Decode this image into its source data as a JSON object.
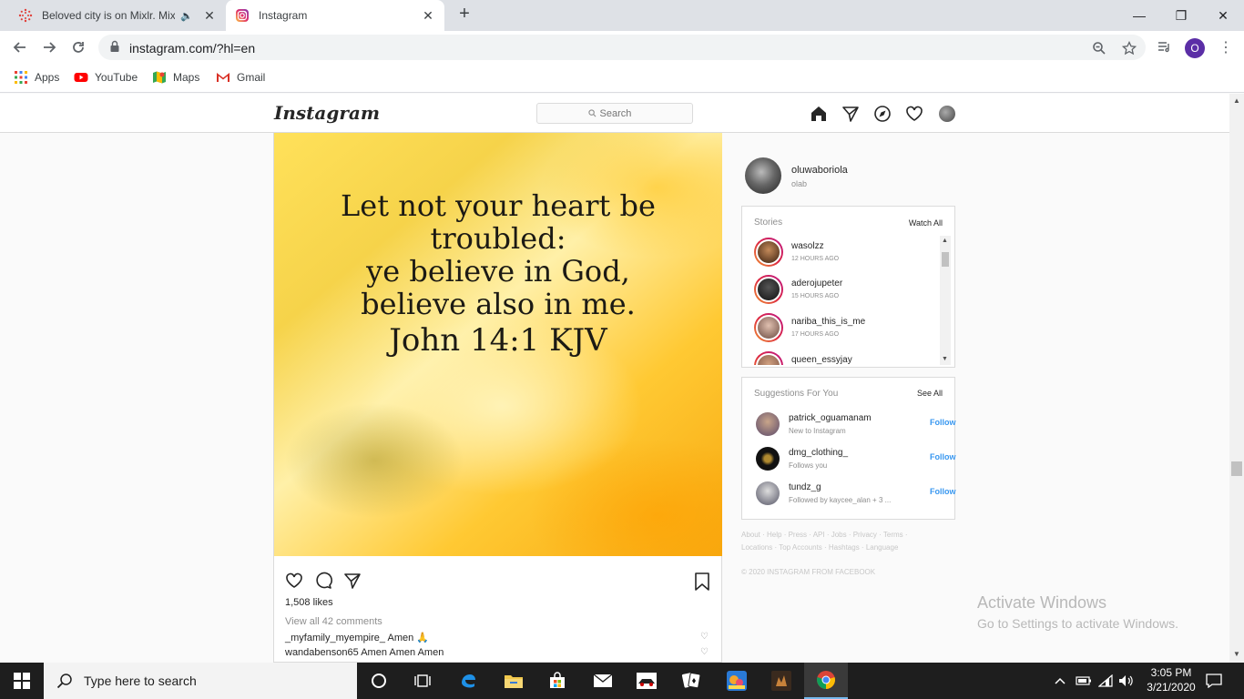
{
  "browser": {
    "tabs": [
      {
        "title": "Beloved city is on Mixlr. Mixlr",
        "audio_icon": "speaker-icon",
        "active": false
      },
      {
        "title": "Instagram",
        "active": true
      }
    ],
    "url": "instagram.com/?hl=en",
    "profile_initial": "O",
    "bookmarks": [
      {
        "label": "Apps",
        "icon": "apps-grid-icon"
      },
      {
        "label": "YouTube",
        "icon": "youtube-icon"
      },
      {
        "label": "Maps",
        "icon": "maps-icon"
      },
      {
        "label": "Gmail",
        "icon": "gmail-icon"
      }
    ]
  },
  "instagram": {
    "logo": "Instagram",
    "search_placeholder": "Search",
    "post": {
      "verse_lines": [
        "Let not your heart be troubled:",
        "ye believe in God,",
        "believe also in me."
      ],
      "reference": "John 14:1 KJV",
      "likes": "1,508 likes",
      "view_comments": "View all 42 comments",
      "comments": [
        {
          "user": "_myfamily_myempire_",
          "text": "Amen 🙏"
        },
        {
          "user": "wandabenson65",
          "text": "Amen Amen Amen"
        }
      ]
    },
    "profile": {
      "username": "oluwaboriola",
      "name": "olab"
    },
    "stories": {
      "title": "Stories",
      "link": "Watch All",
      "items": [
        {
          "user": "wasolzz",
          "time": "12 HOURS AGO"
        },
        {
          "user": "aderojupeter",
          "time": "15 HOURS AGO"
        },
        {
          "user": "nariba_this_is_me",
          "time": "17 HOURS AGO"
        },
        {
          "user": "queen_essyjay",
          "time": ""
        }
      ]
    },
    "suggestions": {
      "title": "Suggestions For You",
      "link": "See All",
      "items": [
        {
          "user": "patrick_oguamanam",
          "sub": "New to Instagram",
          "action": "Follow"
        },
        {
          "user": "dmg_clothing_",
          "sub": "Follows you",
          "action": "Follow"
        },
        {
          "user": "tundz_g",
          "sub": "Followed by kaycee_alan + 3 ...",
          "action": "Follow"
        }
      ]
    },
    "footer_line1": "About · Help · Press · API · Jobs · Privacy · Terms ·",
    "footer_line2": "Locations · Top Accounts · Hashtags · Language",
    "copyright": "© 2020 INSTAGRAM FROM FACEBOOK"
  },
  "watermark": {
    "line1": "Activate Windows",
    "line2": "Go to Settings to activate Windows."
  },
  "taskbar": {
    "search_placeholder": "Type here to search",
    "time": "3:05 PM",
    "date": "3/21/2020"
  }
}
